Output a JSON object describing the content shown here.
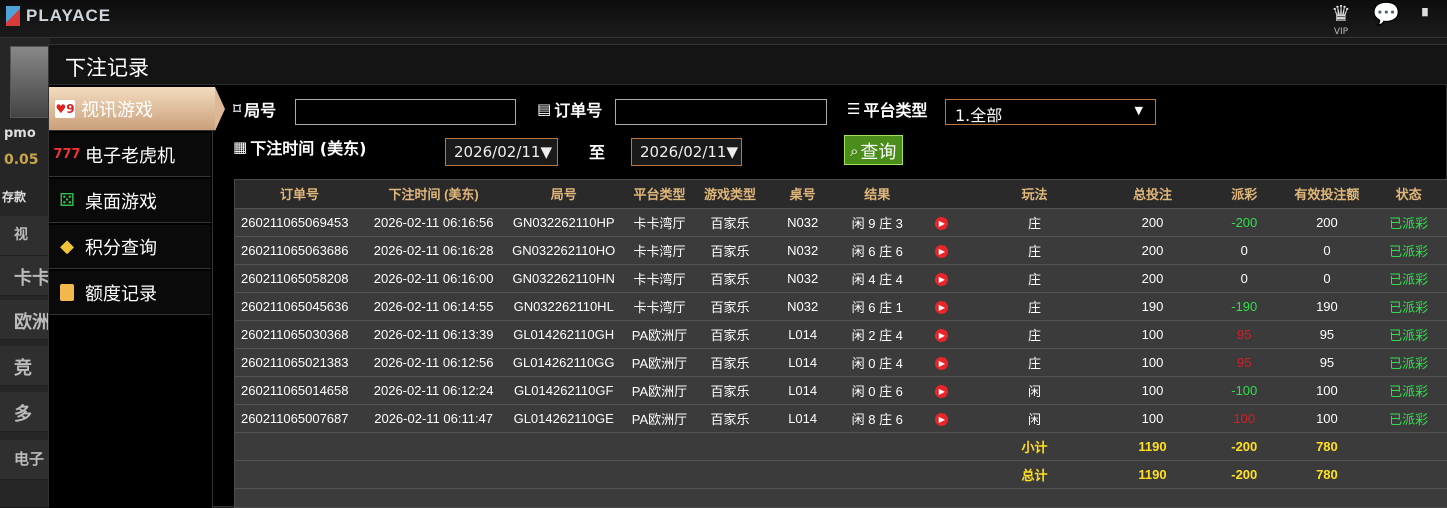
{
  "app": {
    "brand": "PLAYACE",
    "vip_label": "VIP"
  },
  "background": {
    "username": "pmo",
    "balance": "0.05",
    "deposit": "存款",
    "items": [
      "视",
      "卡卡",
      "欧洲",
      "竞",
      "多",
      "电子"
    ]
  },
  "modal": {
    "title": "下注记录"
  },
  "sidenav": [
    {
      "label": "视讯游戏",
      "icon": "playing-cards-icon",
      "active": true
    },
    {
      "label": "电子老虎机",
      "icon": "slot-777-icon",
      "active": false
    },
    {
      "label": "桌面游戏",
      "icon": "dice-icon",
      "active": false
    },
    {
      "label": "积分查询",
      "icon": "diamond-icon",
      "active": false
    },
    {
      "label": "额度记录",
      "icon": "document-icon",
      "active": false
    }
  ],
  "filters": {
    "round_label": "局号",
    "round_value": "",
    "order_label": "订单号",
    "order_value": "",
    "platform_label": "平台类型",
    "platform_value": "1.全部",
    "time_label": "下注时间 (美东)",
    "date_from": "2026/02/11",
    "to_label": "至",
    "date_to": "2026/02/11",
    "query_label": "查询"
  },
  "table": {
    "headers": [
      "订单号",
      "下注时间 (美东)",
      "局号",
      "平台类型",
      "游戏类型",
      "桌号",
      "结果",
      "",
      "玩法",
      "总投注",
      "派彩",
      "有效投注额",
      "状态"
    ],
    "rows": [
      [
        "260211065069453",
        "2026-02-11 06:16:56",
        "GN032262110HP",
        "卡卡湾厅",
        "百家乐",
        "N032",
        "闲 9 庄 3",
        "庄",
        "200",
        "-200",
        "200",
        "已派彩"
      ],
      [
        "260211065063686",
        "2026-02-11 06:16:28",
        "GN032262110HO",
        "卡卡湾厅",
        "百家乐",
        "N032",
        "闲 6 庄 6",
        "庄",
        "200",
        "0",
        "0",
        "已派彩"
      ],
      [
        "260211065058208",
        "2026-02-11 06:16:00",
        "GN032262110HN",
        "卡卡湾厅",
        "百家乐",
        "N032",
        "闲 4 庄 4",
        "庄",
        "200",
        "0",
        "0",
        "已派彩"
      ],
      [
        "260211065045636",
        "2026-02-11 06:14:55",
        "GN032262110HL",
        "卡卡湾厅",
        "百家乐",
        "N032",
        "闲 6 庄 1",
        "庄",
        "190",
        "-190",
        "190",
        "已派彩"
      ],
      [
        "260211065030368",
        "2026-02-11 06:13:39",
        "GL014262110GH",
        "PA欧洲厅",
        "百家乐",
        "L014",
        "闲 2 庄 4",
        "庄",
        "100",
        "95",
        "95",
        "已派彩"
      ],
      [
        "260211065021383",
        "2026-02-11 06:12:56",
        "GL014262110GG",
        "PA欧洲厅",
        "百家乐",
        "L014",
        "闲 0 庄 4",
        "庄",
        "100",
        "95",
        "95",
        "已派彩"
      ],
      [
        "260211065014658",
        "2026-02-11 06:12:24",
        "GL014262110GF",
        "PA欧洲厅",
        "百家乐",
        "L014",
        "闲 0 庄 6",
        "闲",
        "100",
        "-100",
        "100",
        "已派彩"
      ],
      [
        "260211065007687",
        "2026-02-11 06:11:47",
        "GL014262110GE",
        "PA欧洲厅",
        "百家乐",
        "L014",
        "闲 8 庄 6",
        "闲",
        "100",
        "100",
        "100",
        "已派彩"
      ]
    ],
    "subtotal": {
      "label": "小计",
      "total_bet": "1190",
      "payout": "-200",
      "valid": "780"
    },
    "total": {
      "label": "总计",
      "total_bet": "1190",
      "payout": "-200",
      "valid": "780"
    }
  },
  "colors": {
    "gain": "#2fe04a",
    "loss": "#d61e2a",
    "status": "#2fe04a",
    "sum": "#ffe021",
    "header": "#e0b77a"
  }
}
